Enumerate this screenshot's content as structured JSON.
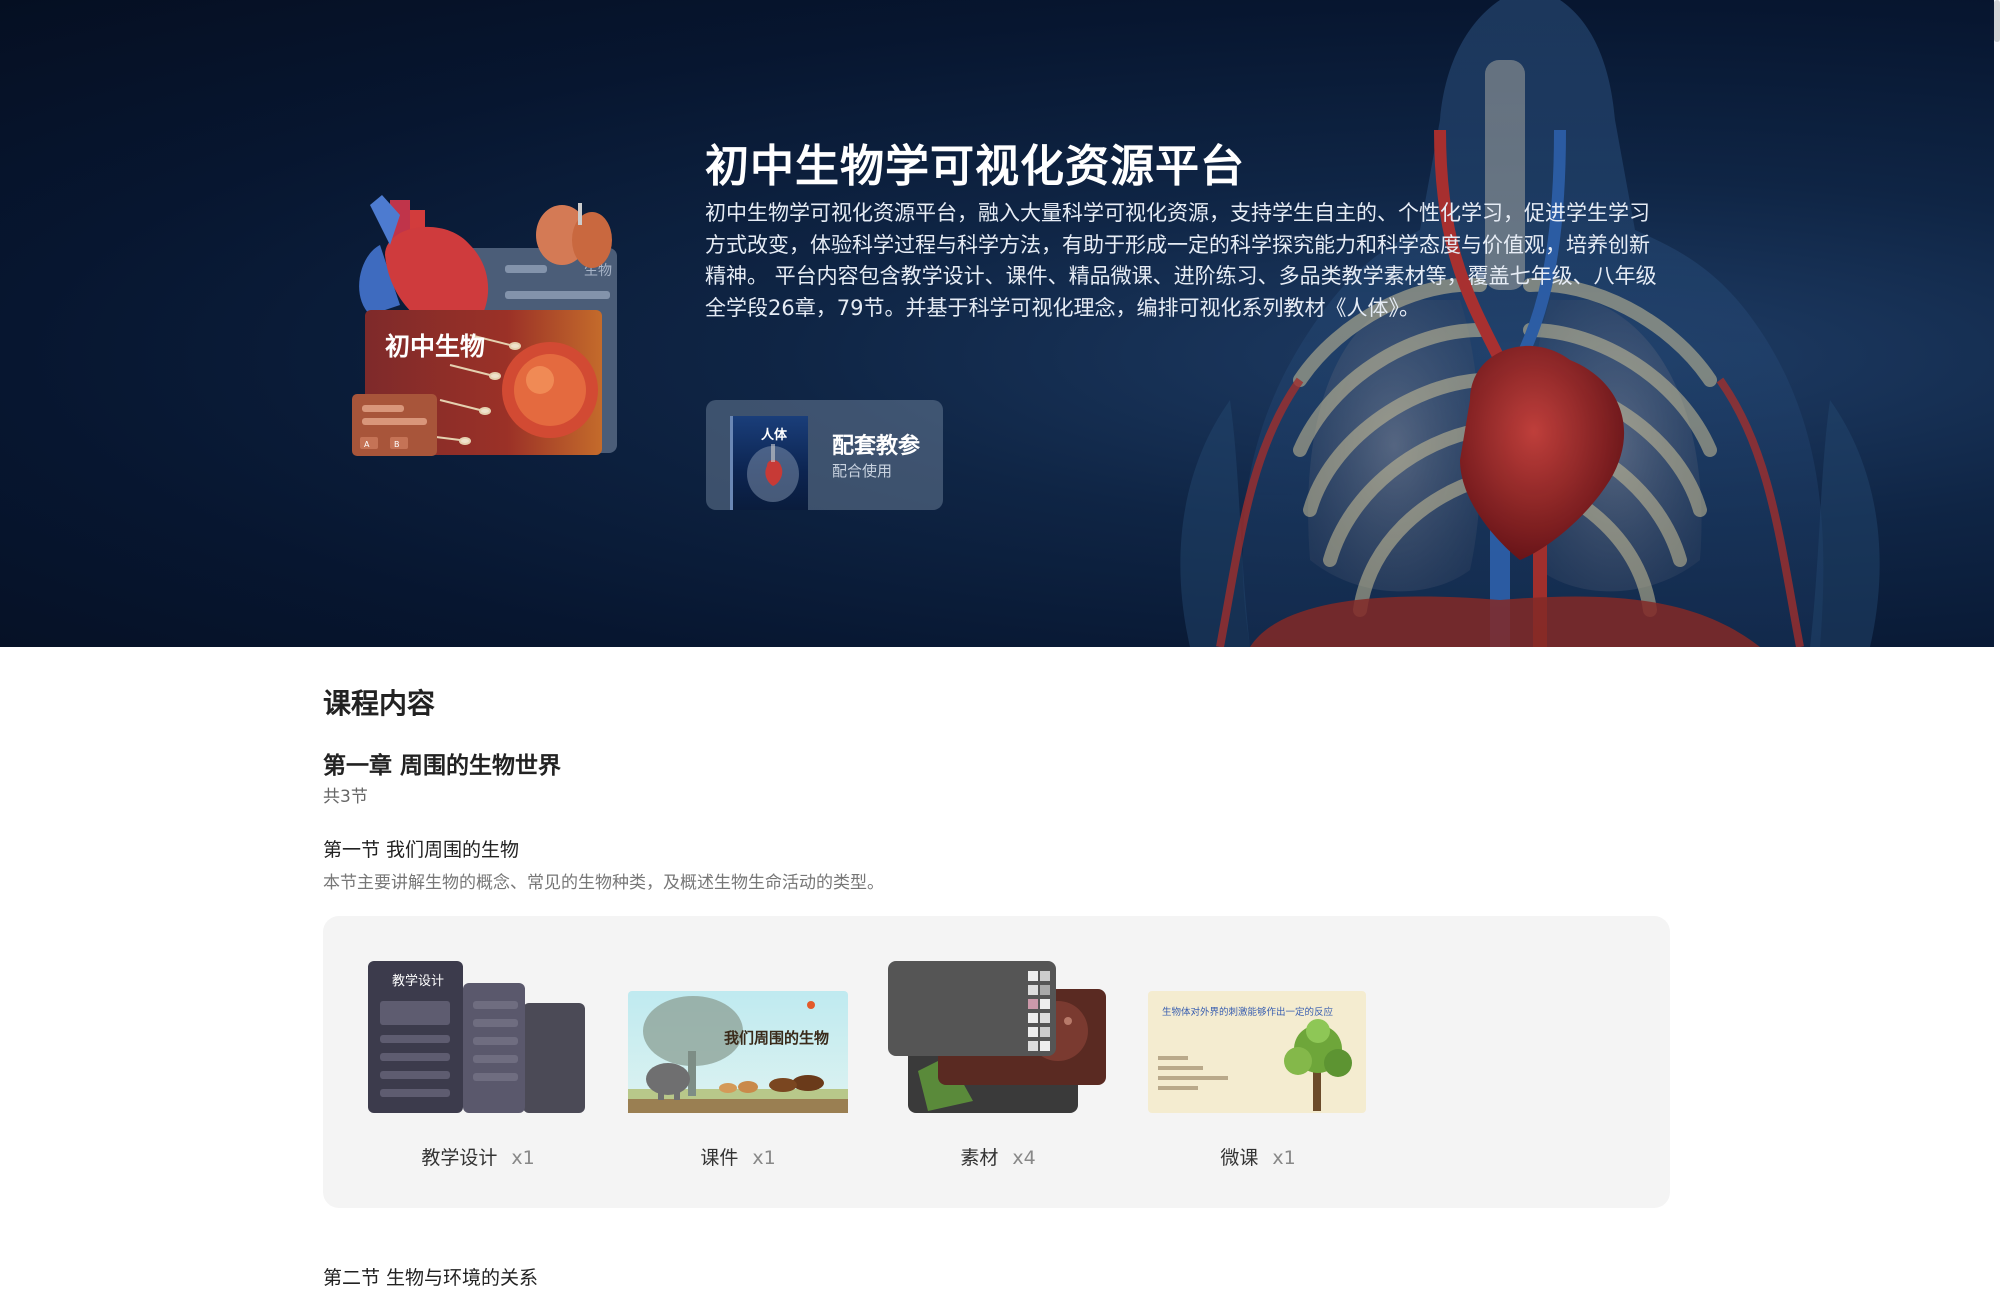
{
  "hero": {
    "title": "初中生物学可视化资源平台",
    "description": "初中生物学可视化资源平台，融入大量科学可视化资源，支持学生自主的、个性化学习，促进学生学习方式改变，体验科学过程与科学方法，有助于形成一定的科学探究能力和科学态度与价值观，培养创新精神。 平台内容包含教学设计、课件、精品微课、进阶练习、多品类教学素材等，覆盖七年级、八年级全学段26章，79节。并基于科学可视化理念，编排可视化系列教材《人体》。",
    "art": {
      "main_label": "初中生物",
      "back_label": "生物",
      "small_options": [
        "A",
        "B"
      ]
    },
    "guide_card": {
      "book_title": "人体",
      "title": "配套教参",
      "subtitle": "配合使用"
    }
  },
  "content": {
    "heading": "课程内容",
    "chapter": {
      "title": "第一章 周围的生物世界",
      "count": "共3节"
    },
    "lesson1": {
      "title": "第一节 我们周围的生物",
      "description": "本节主要讲解生物的概念、常见的生物种类，及概述生物生命活动的类型。",
      "resources": [
        {
          "label": "教学设计",
          "count": "x1",
          "thumb_text": "教学设计"
        },
        {
          "label": "课件",
          "count": "x1",
          "thumb_text": "我们周围的生物"
        },
        {
          "label": "素材",
          "count": "x4"
        },
        {
          "label": "微课",
          "count": "x1",
          "thumb_text": "生物体对外界的刺激能够作出一定的反应"
        }
      ]
    },
    "lesson2": {
      "title": "第二节 生物与环境的关系"
    }
  },
  "colors": {
    "hero_bg": "#071630",
    "panel_bg": "#f4f4f4",
    "guide_card_bg": "#5b6e86"
  }
}
